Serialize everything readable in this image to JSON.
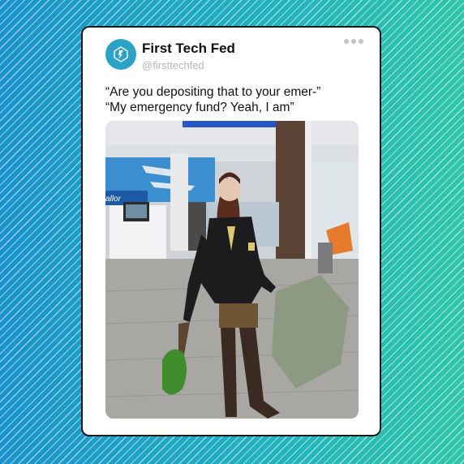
{
  "post": {
    "account_name": "First Tech Fed",
    "handle": "@firsttechfed",
    "avatar_icon": "first-tech-fed-logo-icon",
    "menu_icon": "more-options-icon",
    "caption_lines": [
      "“Are you depositing that to your emer-”",
      "“My emergency fund? Yeah, I am”"
    ],
    "wall_sign_text": "allor",
    "colors": {
      "brand": "#2aa3c6",
      "background_start": "#1a93cc",
      "background_end": "#2fc6a8"
    }
  }
}
